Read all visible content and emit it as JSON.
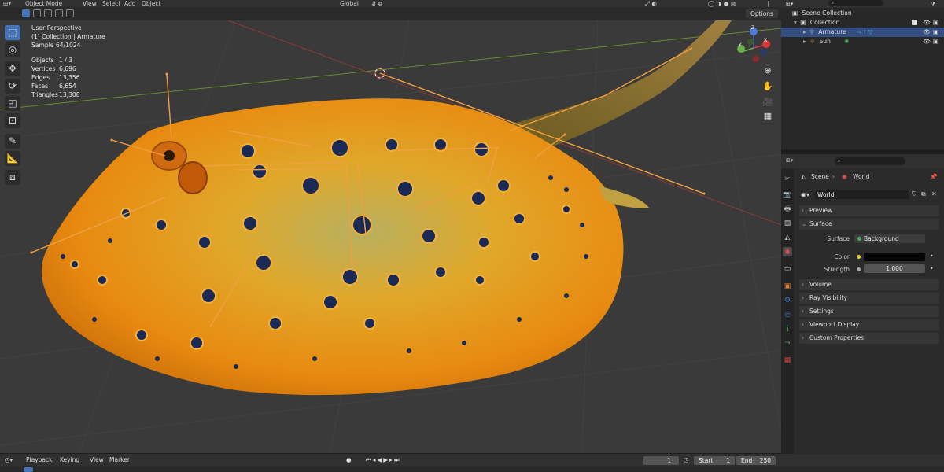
{
  "header": {
    "mode": "Object Mode",
    "menus": [
      "View",
      "Select",
      "Add",
      "Object"
    ],
    "transform_orientation": "Global",
    "options_label": "Options"
  },
  "viewport": {
    "view_name": "User Perspective",
    "collection_prefix": "(1) Collection | ",
    "active_object": "Armature",
    "sample": "Sample 64/1024",
    "stats": [
      {
        "label": "Objects",
        "value": "1 / 3"
      },
      {
        "label": "Vertices",
        "value": "6,696"
      },
      {
        "label": "Edges",
        "value": "13,356"
      },
      {
        "label": "Faces",
        "value": "6,654"
      },
      {
        "label": "Triangles",
        "value": "13,308"
      }
    ],
    "gizmo": {
      "x": "X",
      "y": "Y",
      "z": "Z"
    }
  },
  "outliner": {
    "root": "Scene Collection",
    "collection": "Collection",
    "items": [
      {
        "name": "Armature",
        "selected": true
      },
      {
        "name": "Sun",
        "selected": false
      }
    ]
  },
  "properties": {
    "breadcrumb_scene": "Scene",
    "breadcrumb_world": "World",
    "world_name": "World",
    "panels": {
      "preview": "Preview",
      "surface": "Surface",
      "volume": "Volume",
      "ray_visibility": "Ray Visibility",
      "settings": "Settings",
      "viewport_display": "Viewport Display",
      "custom_properties": "Custom Properties"
    },
    "surface_label": "Surface",
    "surface_value": "Background",
    "color_label": "Color",
    "strength_label": "Strength",
    "strength_value": "1.000",
    "color_swatch": "#050505"
  },
  "timeline": {
    "menus": [
      "Playback",
      "Keying",
      "View",
      "Marker"
    ],
    "current_frame": "1",
    "start_label": "Start",
    "start_value": "1",
    "end_label": "End",
    "end_value": "250"
  },
  "colors": {
    "accent": "#4772b3",
    "bone": "#f0a040",
    "ray_body": "#e89a18"
  }
}
